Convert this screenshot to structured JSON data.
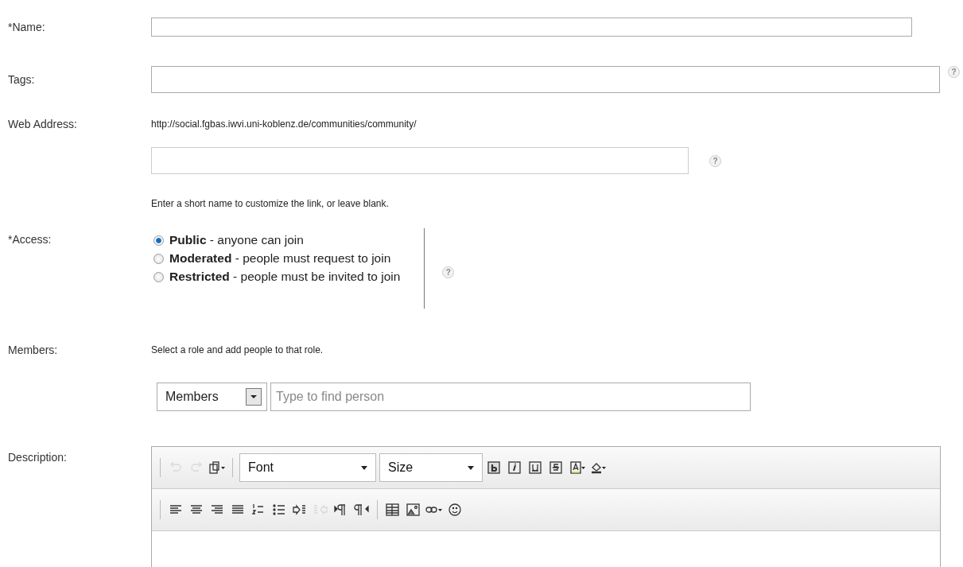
{
  "name_field": {
    "label": "*Name:"
  },
  "tags_field": {
    "label": "Tags:",
    "help": "?"
  },
  "web_address": {
    "label": "Web Address:",
    "url": "http://social.fgbas.iwvi.uni-koblenz.de/communities/community/",
    "help": "?",
    "hint": "Enter a short name to customize the link, or leave blank."
  },
  "access": {
    "label": "*Access:",
    "help": "?",
    "options": [
      {
        "name": "Public",
        "description": " - anyone can join",
        "selected": true
      },
      {
        "name": "Moderated",
        "description": " - people must request to join",
        "selected": false
      },
      {
        "name": "Restricted",
        "description": " - people must be invited to join",
        "selected": false
      }
    ]
  },
  "members": {
    "label": "Members:",
    "instruction": "Select a role and add people to that role.",
    "role": "Members",
    "placeholder": "Type to find person"
  },
  "description": {
    "label": "Description:",
    "font": "Font",
    "size": "Size",
    "toolbar_row_1": [
      {
        "kind": "undo",
        "disabled": true
      },
      {
        "kind": "redo",
        "disabled": true
      },
      {
        "kind": "paste",
        "disabled": false
      },
      {
        "kind": "fontsel"
      },
      {
        "kind": "sizesel"
      },
      {
        "kind": "bold",
        "disabled": false
      },
      {
        "kind": "italic",
        "disabled": false
      },
      {
        "kind": "underline",
        "disabled": false
      },
      {
        "kind": "strike",
        "disabled": false
      },
      {
        "kind": "textcolor",
        "disabled": false
      },
      {
        "kind": "bgcolor",
        "disabled": false
      }
    ],
    "toolbar_row_2": [
      {
        "kind": "alignleft",
        "disabled": false
      },
      {
        "kind": "aligncenter",
        "disabled": false
      },
      {
        "kind": "alignright",
        "disabled": false
      },
      {
        "kind": "justify",
        "disabled": false
      },
      {
        "kind": "numbered",
        "disabled": false
      },
      {
        "kind": "bullets",
        "disabled": false
      },
      {
        "kind": "indent",
        "disabled": false
      },
      {
        "kind": "outdent",
        "disabled": true
      },
      {
        "kind": "ltr",
        "disabled": false
      },
      {
        "kind": "rtl",
        "disabled": false
      },
      {
        "kind": "table",
        "disabled": false
      },
      {
        "kind": "image",
        "disabled": false
      },
      {
        "kind": "link",
        "disabled": false
      },
      {
        "kind": "smiley",
        "disabled": false
      }
    ]
  }
}
